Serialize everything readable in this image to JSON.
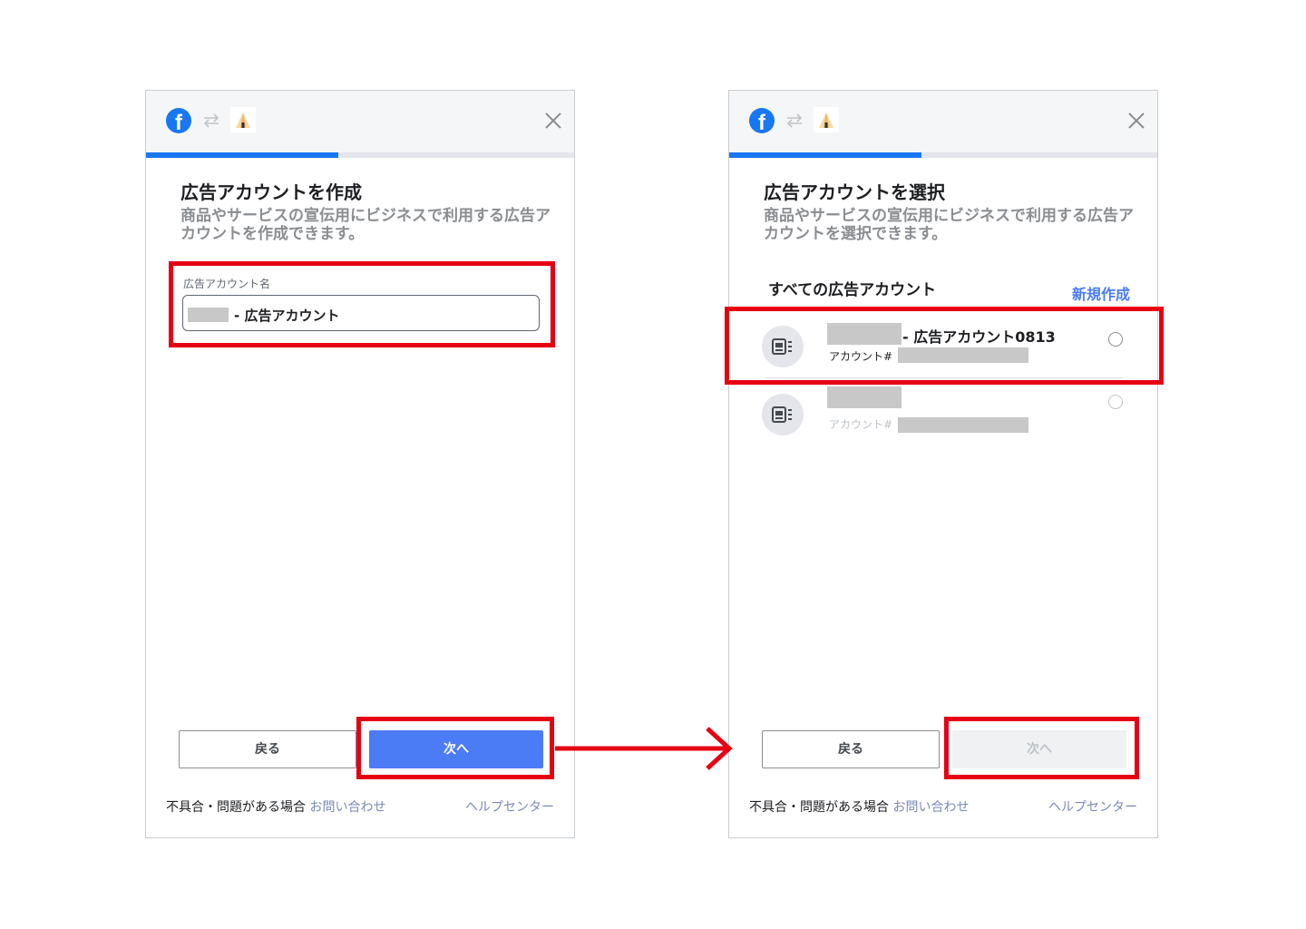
{
  "left_panel": {
    "title": "広告アカウントを作成",
    "description": "商品やサービスの宣伝用にビジネスで利用する広告アカウントを作成できます。",
    "field_label": "広告アカウント名",
    "field_value": "- 広告アカウント",
    "progress": 0.45,
    "back_label": "戻る",
    "next_label": "次へ",
    "footer_text": "不具合・問題がある場合",
    "footer_link": "お問い合わせ",
    "help_link": "ヘルプセンター"
  },
  "right_panel": {
    "title": "広告アカウントを選択",
    "description": "商品やサービスの宣伝用にビジネスで利用する広告アカウントを選択できます。",
    "section_title": "すべての広告アカウント",
    "new_link": "新規作成",
    "progress": 0.45,
    "accounts": [
      {
        "name": "- 広告アカウント0813",
        "id_label": "アカウント#"
      },
      {
        "name": "",
        "id_label": "アカウント#"
      }
    ],
    "back_label": "戻る",
    "next_label": "次へ",
    "footer_text": "不具合・問題がある場合",
    "footer_link": "お問い合わせ",
    "help_link": "ヘルプセンター"
  },
  "icons": {
    "brand": "facebook-logo",
    "swap": "swap-arrows-icon",
    "app": "tent-logo",
    "close": "close-icon",
    "account": "ad-account-icon"
  },
  "colors": {
    "facebook_blue": "#1877f2",
    "primary_button": "#4b7bf5",
    "highlight_red": "#e60012",
    "link": "#7a8ab4"
  }
}
